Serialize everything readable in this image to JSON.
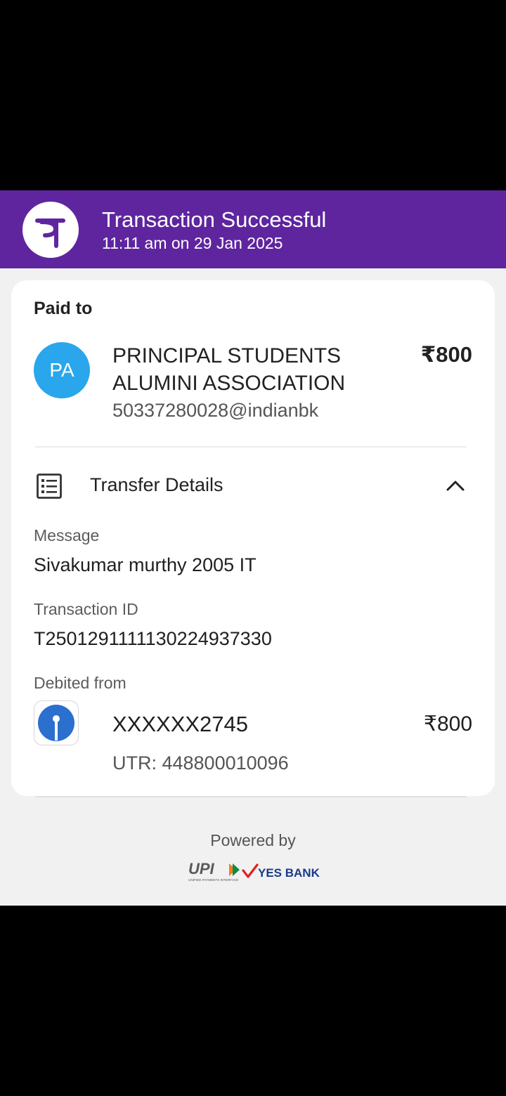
{
  "header": {
    "title": "Transaction Successful",
    "subtitle": "11:11 am on 29 Jan 2025",
    "logo_icon": "phonepe-logo",
    "background_color": "#5f259f"
  },
  "paid_to": {
    "heading": "Paid to",
    "avatar_initials": "PA",
    "avatar_color": "#29a6ec",
    "payee_line1": "PRINCIPAL STUDENTS",
    "payee_line2": "ALUMINI ASSOCIATION",
    "amount": "₹800",
    "upi_id": "50337280028@indianbk"
  },
  "transfer_details": {
    "label": "Transfer Details",
    "icon": "receipt-list-icon",
    "toggle_icon": "chevron-up-icon",
    "message_label": "Message",
    "message_value": "Sivakumar murthy 2005 IT",
    "txn_id_label": "Transaction ID",
    "txn_id_value": "T2501291111130224937330",
    "debited_label": "Debited from",
    "bank_icon": "sbi-bank-icon",
    "account": "XXXXXX2745",
    "debit_amount": "₹800",
    "utr": "UTR: 448800010096"
  },
  "footer": {
    "powered_by": "Powered by",
    "upi_logo": "UPI",
    "upi_tagline": "UNIFIED PAYMENTS INTERFACE",
    "bank_logo": "YES BANK"
  }
}
